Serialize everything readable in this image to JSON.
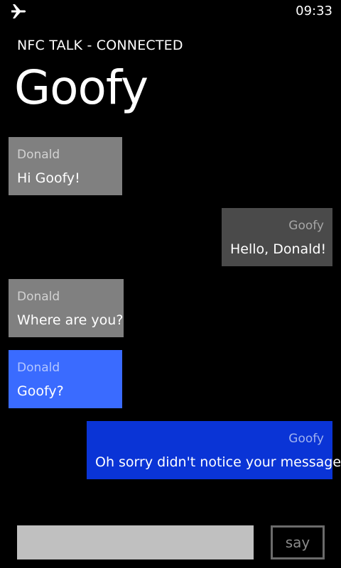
{
  "status_bar": {
    "time": "09:33",
    "icon": "airplane-icon"
  },
  "header": {
    "app_title": "NFC TALK - CONNECTED",
    "page_title": "Goofy"
  },
  "messages": [
    {
      "sender": "Donald",
      "text": "Hi Goofy!",
      "align": "left",
      "background": "#808080",
      "sender_color": "#d2d2d2"
    },
    {
      "sender": "Goofy",
      "text": "Hello, Donald!",
      "align": "right",
      "background": "#4a4a4a",
      "sender_color": "#a6a6a6"
    },
    {
      "sender": "Donald",
      "text": "Where are you?",
      "align": "left",
      "background": "#808080",
      "sender_color": "#d2d2d2"
    },
    {
      "sender": "Donald",
      "text": "Goofy?",
      "align": "left",
      "background": "#3a6bff",
      "sender_color": "#b4c6ff"
    },
    {
      "sender": "Goofy",
      "text": "Oh sorry didn't notice your message!",
      "align": "right",
      "background": "#0a34d6",
      "sender_color": "#a0b2f0"
    }
  ],
  "composer": {
    "input_value": "",
    "say_label": "say"
  }
}
